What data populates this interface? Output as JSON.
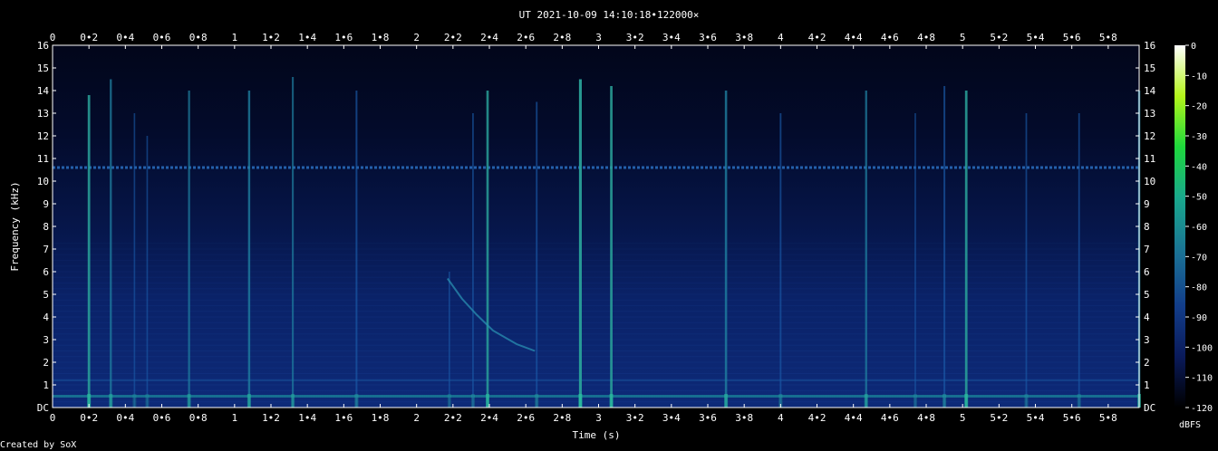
{
  "chart_data": {
    "type": "heatmap",
    "title": "UT 2021-10-09 14:10:18•122000×",
    "xlabel": "Time (s)",
    "ylabel": "Frequency (kHz)",
    "xlim": [
      0,
      5.97
    ],
    "ylim": [
      0,
      16
    ],
    "x_tick_labels": [
      "0",
      "0•2",
      "0•4",
      "0•6",
      "0•8",
      "1",
      "1•2",
      "1•4",
      "1•6",
      "1•8",
      "2",
      "2•2",
      "2•4",
      "2•6",
      "2•8",
      "3",
      "3•2",
      "3•4",
      "3•6",
      "3•8",
      "4",
      "4•2",
      "4•4",
      "4•6",
      "4•8",
      "5",
      "5•2",
      "5•4",
      "5•6",
      "5•8"
    ],
    "y_tick_labels": [
      "DC",
      "1",
      "2",
      "3",
      "4",
      "5",
      "6",
      "7",
      "8",
      "9",
      "10",
      "11",
      "12",
      "13",
      "14",
      "15",
      "16"
    ],
    "colorbar": {
      "label": "dBFS",
      "range": [
        -120,
        0
      ],
      "tick_labels": [
        "0",
        "-10",
        "-20",
        "-30",
        "-40",
        "-50",
        "-60",
        "-70",
        "-80",
        "-90",
        "-100",
        "-110",
        "-120"
      ],
      "colors": [
        "#000000",
        "#0a1a5a",
        "#123d8a",
        "#1a6f95",
        "#19a88c",
        "#1ed83c",
        "#b4f51a",
        "#ffffff"
      ]
    },
    "background_level_dbfs": -105,
    "hum_line_khz": 10.6,
    "low_band_khz": [
      0.5,
      1.2
    ],
    "impulses": [
      {
        "t": 0.2,
        "fmax": 13.8,
        "level": 0.8
      },
      {
        "t": 0.32,
        "fmax": 14.5,
        "level": 0.6
      },
      {
        "t": 0.45,
        "fmax": 13.0,
        "level": 0.3
      },
      {
        "t": 0.52,
        "fmax": 12.0,
        "level": 0.3
      },
      {
        "t": 0.75,
        "fmax": 14.0,
        "level": 0.55
      },
      {
        "t": 1.08,
        "fmax": 14.0,
        "level": 0.65
      },
      {
        "t": 1.32,
        "fmax": 14.6,
        "level": 0.5
      },
      {
        "t": 1.67,
        "fmax": 14.0,
        "level": 0.45
      },
      {
        "t": 2.18,
        "fmax": 6.0,
        "level": 0.3
      },
      {
        "t": 2.31,
        "fmax": 13.0,
        "level": 0.35
      },
      {
        "t": 2.39,
        "fmax": 14.0,
        "level": 0.75
      },
      {
        "t": 2.66,
        "fmax": 13.5,
        "level": 0.4
      },
      {
        "t": 2.9,
        "fmax": 14.5,
        "level": 0.95
      },
      {
        "t": 3.07,
        "fmax": 14.2,
        "level": 0.8
      },
      {
        "t": 3.7,
        "fmax": 14.0,
        "level": 0.7
      },
      {
        "t": 4.0,
        "fmax": 13.0,
        "level": 0.4
      },
      {
        "t": 4.47,
        "fmax": 14.0,
        "level": 0.6
      },
      {
        "t": 4.74,
        "fmax": 13.0,
        "level": 0.3
      },
      {
        "t": 4.9,
        "fmax": 14.2,
        "level": 0.45
      },
      {
        "t": 5.02,
        "fmax": 14.0,
        "level": 0.8
      },
      {
        "t": 5.35,
        "fmax": 13.0,
        "level": 0.35
      },
      {
        "t": 5.64,
        "fmax": 13.0,
        "level": 0.35
      },
      {
        "t": 5.97,
        "fmax": 14.0,
        "level": 0.7
      }
    ],
    "sweep": {
      "points_t_khz": [
        [
          2.17,
          5.7
        ],
        [
          2.25,
          4.8
        ],
        [
          2.33,
          4.1
        ],
        [
          2.42,
          3.4
        ],
        [
          2.55,
          2.8
        ],
        [
          2.65,
          2.5
        ]
      ],
      "level": 0.45
    }
  },
  "footer": {
    "credit": "Created by SoX"
  }
}
